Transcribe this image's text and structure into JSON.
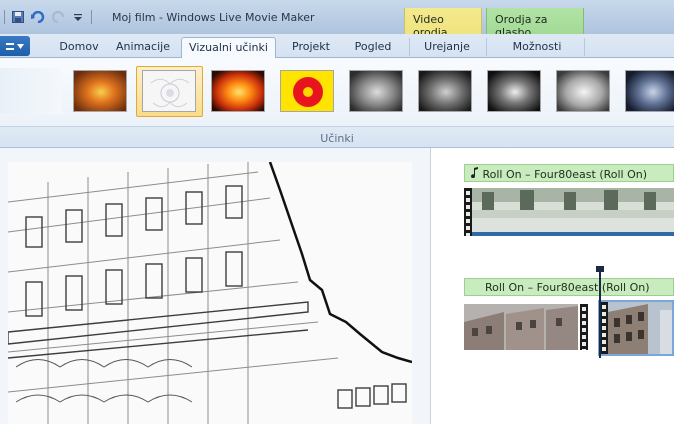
{
  "window": {
    "title": "Moj film - Windows Live Movie Maker",
    "contextual_tabs": [
      {
        "label": "Video orodja",
        "color": "#f2e686"
      },
      {
        "label": "Orodja za glasbo",
        "color": "#aadc9c"
      }
    ]
  },
  "quick_access": {
    "icons": [
      "save-icon",
      "undo-icon",
      "redo-icon",
      "customize-dropdown-icon"
    ]
  },
  "ribbon_tabs": [
    {
      "label": "Domov"
    },
    {
      "label": "Animacije"
    },
    {
      "label": "Vizualni učinki",
      "active": true
    },
    {
      "label": "Projekt"
    },
    {
      "label": "Pogled"
    },
    {
      "label": "Urejanje"
    },
    {
      "label": "Možnosti"
    }
  ],
  "effects": {
    "group_label": "Učinki",
    "selected_index": 1,
    "items": [
      {
        "style": "none"
      },
      {
        "style": "warm"
      },
      {
        "style": "edge-detect"
      },
      {
        "style": "saturated"
      },
      {
        "style": "yellow-red"
      },
      {
        "style": "grayscale"
      },
      {
        "style": "grayscale-dark"
      },
      {
        "style": "grayscale-contrast"
      },
      {
        "style": "grayscale-light"
      },
      {
        "style": "blue-tint"
      }
    ]
  },
  "storyboard": {
    "tracks": [
      {
        "music_label": "Roll On – Four80east (Roll On)",
        "note_icon": "music-note-icon"
      },
      {
        "music_label": "Roll On – Four80east (Roll On)"
      }
    ]
  },
  "colors": {
    "accent": "#1f5ea8",
    "music_bar": "#c8ecbd",
    "selected_effect": "#f9dc8a"
  }
}
